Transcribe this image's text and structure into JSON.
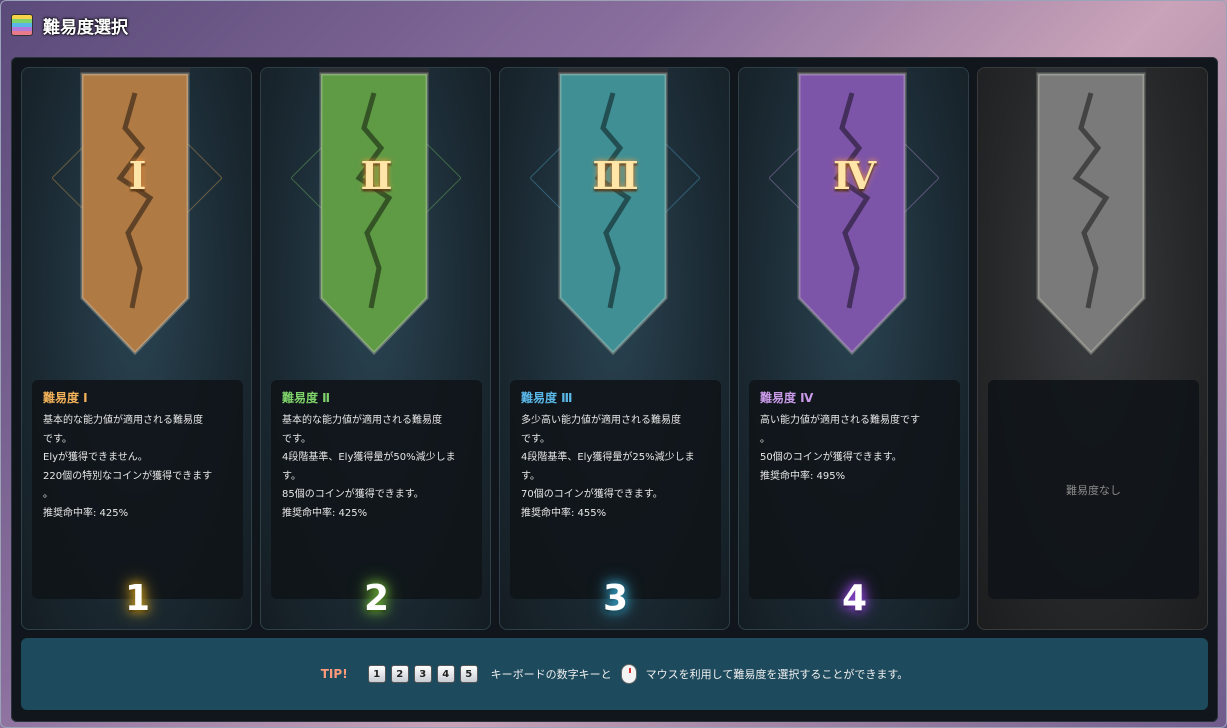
{
  "window": {
    "title": "難易度選択"
  },
  "cards": [
    {
      "numeral": "Ⅰ",
      "title": "難易度 Ⅰ",
      "title_color": "#f2b25a",
      "banner_color": "#b07a45",
      "numeral_glow": "#ff9a3a",
      "key_glow": "#e8b020",
      "key": "1",
      "lines": [
        "基本的な能力値が適用される難易度",
        "です。",
        "Elyが獲得できません。",
        "220個の特別なコインが獲得できます",
        "。",
        "推奨命中率: 425%"
      ]
    },
    {
      "numeral": "Ⅱ",
      "title": "難易度 Ⅱ",
      "title_color": "#7fd36a",
      "banner_color": "#5f9a45",
      "numeral_glow": "#ff9a3a",
      "key_glow": "#7ac83a",
      "key": "2",
      "lines": [
        "基本的な能力値が適用される難易度",
        "です。",
        "4段階基準、Ely獲得量が50%減少しま",
        "す。",
        "85個のコインが獲得できます。",
        "推奨命中率: 425%"
      ]
    },
    {
      "numeral": "Ⅲ",
      "title": "難易度 Ⅲ",
      "title_color": "#5ab8e8",
      "banner_color": "#3f8f95",
      "numeral_glow": "#ff9a3a",
      "key_glow": "#3ab0d8",
      "key": "3",
      "lines": [
        "多少高い能力値が適用される難易度",
        "です。",
        "4段階基準、Ely獲得量が25%減少しま",
        "す。",
        "70個のコインが獲得できます。",
        "推奨命中率: 455%"
      ]
    },
    {
      "numeral": "Ⅳ",
      "title": "難易度 Ⅳ",
      "title_color": "#c89ae8",
      "banner_color": "#7d55a8",
      "numeral_glow": "#ff9a3a",
      "key_glow": "#9a4ae8",
      "key": "4",
      "lines": [
        "高い能力値が適用される難易度です",
        "。",
        "50個のコインが獲得できます。",
        "推奨命中率: 495%"
      ]
    },
    {
      "numeral": "",
      "title": "",
      "title_color": "#8a8a8a",
      "banner_color": "#7a7a7a",
      "numeral_glow": "#000000",
      "key_glow": "#000000",
      "key": "",
      "empty_text": "難易度なし",
      "lines": []
    }
  ],
  "tip": {
    "label": "TIP!",
    "keys": [
      "1",
      "2",
      "3",
      "4",
      "5"
    ],
    "text_before_mouse": "キーボードの数字キーと",
    "text_after_mouse": "マウスを利用して難易度を選択することができます。"
  }
}
